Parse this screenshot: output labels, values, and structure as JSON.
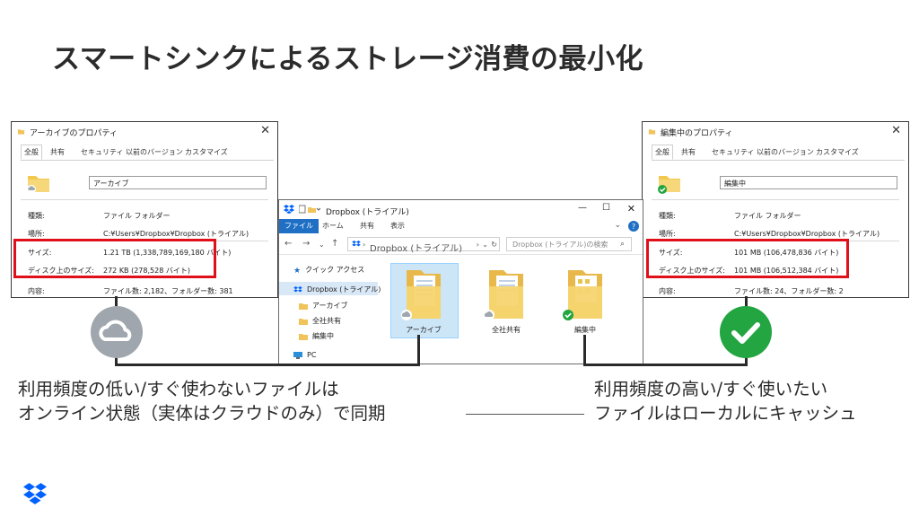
{
  "slide": {
    "title": "スマートシンクによるストレージ消費の最小化"
  },
  "colors": {
    "highlight": "#e0101a",
    "ribbon_file": "#1f6fc5",
    "status_online": "#9fa6ad",
    "status_synced": "#23a541",
    "dropbox_blue": "#0061fe"
  },
  "left_dialog": {
    "title": "アーカイブのプロパティ",
    "tabs": [
      "全般",
      "共有",
      "セキュリティ",
      "以前のバージョン",
      "カスタマイズ"
    ],
    "name_value": "アーカイブ",
    "props": [
      {
        "label": "種類:",
        "value": "ファイル フォルダー"
      },
      {
        "label": "場所:",
        "value": "C:¥Users¥Dropbox¥Dropbox (トライアル)"
      },
      {
        "label": "サイズ:",
        "value": "1.21 TB (1,338,789,169,180 バイト)"
      },
      {
        "label": "ディスク上のサイズ:",
        "value": "272 KB (278,528 バイト)"
      },
      {
        "label": "内容:",
        "value": "ファイル数: 2,182、フォルダー数: 381"
      }
    ],
    "close": "✕"
  },
  "right_dialog": {
    "title": "編集中のプロパティ",
    "tabs": [
      "全般",
      "共有",
      "セキュリティ",
      "以前のバージョン",
      "カスタマイズ"
    ],
    "name_value": "編集中",
    "props": [
      {
        "label": "種類:",
        "value": "ファイル フォルダー"
      },
      {
        "label": "場所:",
        "value": "C:¥Users¥Dropbox¥Dropbox (トライアル)"
      },
      {
        "label": "サイズ:",
        "value": "101 MB (106,478,836 バイト)"
      },
      {
        "label": "ディスク上のサイズ:",
        "value": "101 MB (106,512,384 バイト)"
      },
      {
        "label": "内容:",
        "value": "ファイル数: 24、フォルダー数: 2"
      }
    ],
    "close": "✕"
  },
  "explorer": {
    "title": "Dropbox (トライアル)",
    "ribbon_tabs": [
      "ファイル",
      "ホーム",
      "共有",
      "表示"
    ],
    "address": "Dropbox (トライアル)",
    "search_placeholder": "Dropbox (トライアル)の検索",
    "sidebar": [
      "クイック アクセス",
      "Dropbox (トライアル)",
      "アーカイブ",
      "全社共有",
      "編集中",
      "PC"
    ],
    "folders": [
      "アーカイブ",
      "全社共有",
      "編集中"
    ],
    "window_controls": [
      "—",
      "☐",
      "✕"
    ]
  },
  "captions": {
    "left": [
      "利用頻度の低い/すぐ使わないファイルは",
      "オンライン状態（実体はクラウドのみ）で同期"
    ],
    "right": [
      "利用頻度の高い/すぐ使いたい",
      "ファイルはローカルにキャッシュ"
    ]
  }
}
